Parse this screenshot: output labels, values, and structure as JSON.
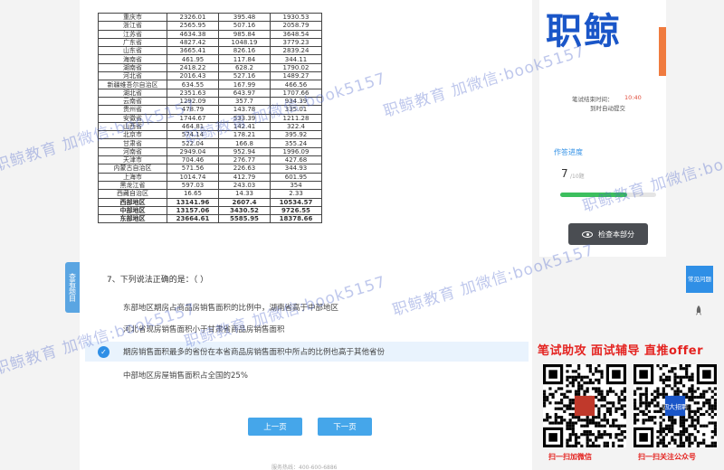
{
  "table": {
    "rows": [
      [
        "重庆市",
        "2326.01",
        "395.48",
        "1930.53"
      ],
      [
        "浙江省",
        "2565.95",
        "507.16",
        "2058.79"
      ],
      [
        "江苏省",
        "4634.38",
        "985.84",
        "3648.54"
      ],
      [
        "广东省",
        "4827.42",
        "1048.19",
        "3779.23"
      ],
      [
        "山东省",
        "3665.41",
        "826.16",
        "2839.24"
      ],
      [
        "海南省",
        "461.95",
        "117.84",
        "344.11"
      ],
      [
        "湖南省",
        "2418.22",
        "628.2",
        "1790.02"
      ],
      [
        "河北省",
        "2016.43",
        "527.16",
        "1489.27"
      ],
      [
        "新疆维吾尔自治区",
        "634.55",
        "167.99",
        "466.56"
      ],
      [
        "湖北省",
        "2351.63",
        "643.97",
        "1707.66"
      ],
      [
        "云南省",
        "1292.09",
        "357.7",
        "934.39"
      ],
      [
        "贵州省",
        "478.79",
        "143.78",
        "335.01"
      ],
      [
        "安徽省",
        "1744.67",
        "533.39",
        "1211.28"
      ],
      [
        "山西省",
        "464.81",
        "142.41",
        "322.4"
      ],
      [
        "北京市",
        "574.14",
        "178.21",
        "395.92"
      ],
      [
        "甘肃省",
        "522.04",
        "166.8",
        "355.24"
      ],
      [
        "河南省",
        "2949.04",
        "952.94",
        "1996.09"
      ],
      [
        "天津市",
        "704.46",
        "276.77",
        "427.68"
      ],
      [
        "内蒙古自治区",
        "571.56",
        "226.63",
        "344.93"
      ],
      [
        "上海市",
        "1014.74",
        "412.79",
        "601.95"
      ],
      [
        "黑龙江省",
        "597.03",
        "243.03",
        "354"
      ],
      [
        "西藏自治区",
        "16.65",
        "14.33",
        "2.33"
      ],
      [
        "西部地区",
        "13141.96",
        "2607.4",
        "10534.57"
      ],
      [
        "中部地区",
        "13157.06",
        "3430.52",
        "9726.55"
      ],
      [
        "东部地区",
        "23664.61",
        "5585.95",
        "18378.66"
      ]
    ],
    "bold_from_index": 22
  },
  "side_tab": "查看题目",
  "question": {
    "number_title": "7、下列说法正确的是：（ ）",
    "options": [
      {
        "text": "东部地区期房占商品房销售面积的比例中，湖南省高于中部地区",
        "selected": false
      },
      {
        "text": "河北省现房销售面积小于甘肃省商品房销售面积",
        "selected": false
      },
      {
        "text": "期房销售面积最多的省份在本省商品房销售面积中所占的比例也高于其他省份",
        "selected": true
      },
      {
        "text": "中部地区房屋销售面积占全国的25%",
        "selected": false
      }
    ]
  },
  "nav": {
    "prev": "上一页",
    "next": "下一页"
  },
  "hotline": "服务热线：400-600-6886",
  "right": {
    "logo": "职鲸",
    "deadline_label": "笔试结束时间：",
    "deadline_time": "10:40",
    "auto_submit": "到时自动提交",
    "progress_title": "作答进度",
    "progress_done": "7",
    "progress_total": "/10题",
    "progress_fraction": 0.7,
    "view_button": "检查本部分",
    "help_button": "常见问题"
  },
  "promo": {
    "title": "笔试助攻  面试辅导  直推offer",
    "qr_left_label": "扫一扫加微信",
    "qr_right_label": "扫一扫关注公众号",
    "qr_right_center": "四大招聘"
  },
  "watermark": "职鲸教育 加微信:book5157",
  "colors": {
    "accent": "#2f8fe6",
    "logo": "#1a56c8",
    "promo": "#e42320",
    "progress": "#3cbf5e"
  }
}
